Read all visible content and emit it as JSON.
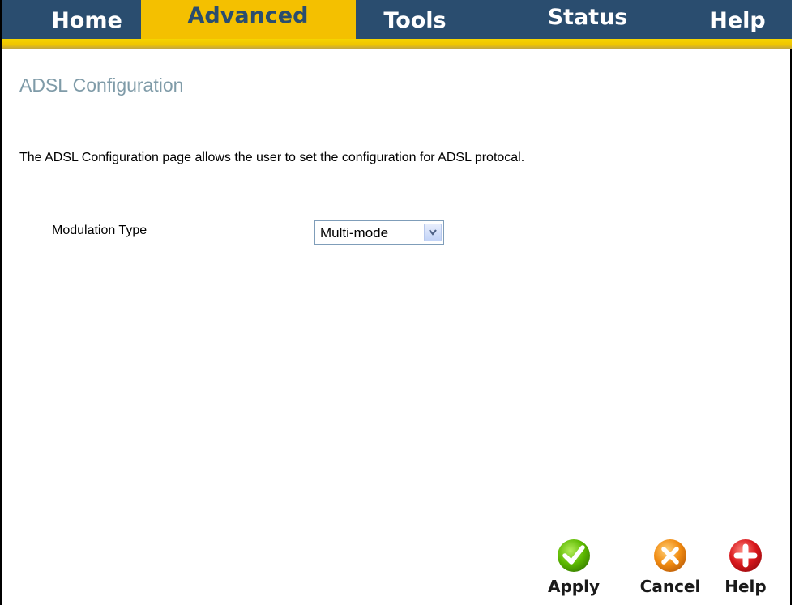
{
  "nav": {
    "tabs": [
      {
        "label": "Home"
      },
      {
        "label": "Advanced"
      },
      {
        "label": "Tools"
      },
      {
        "label": "Status"
      },
      {
        "label": "Help"
      }
    ],
    "active_tab": "Advanced"
  },
  "page": {
    "title": "ADSL Configuration",
    "description": "The ADSL Configuration page allows the user to set the configuration for ADSL protocal."
  },
  "form": {
    "modulation_label": "Modulation Type",
    "modulation_value": "Multi-mode"
  },
  "actions": {
    "apply_label": "Apply",
    "cancel_label": "Cancel",
    "help_label": "Help"
  },
  "colors": {
    "nav_blue": "#2a4d6f",
    "nav_gold": "#f4c000",
    "title_color": "#7f9ba8",
    "apply_green": "#5cb800",
    "cancel_orange": "#f08a10",
    "help_red": "#d8161b"
  },
  "icons": {
    "apply": "checkmark-icon",
    "cancel": "x-icon",
    "help": "plus-icon"
  }
}
